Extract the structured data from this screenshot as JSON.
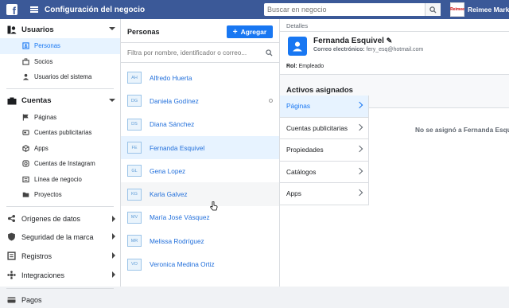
{
  "topbar": {
    "title": "Configuración del negocio",
    "search_placeholder": "Buscar en negocio",
    "account_name": "Reimee Marketing",
    "account_logo_text": "Reimee",
    "brand_color": "#3b5998"
  },
  "sidebar": {
    "users_section": "Usuarios",
    "users_items": [
      {
        "label": "Personas",
        "icon": "person-icon"
      },
      {
        "label": "Socios",
        "icon": "briefcase-icon"
      },
      {
        "label": "Usuarios del sistema",
        "icon": "system-user-icon"
      }
    ],
    "accounts_section": "Cuentas",
    "accounts_items": [
      {
        "label": "Páginas",
        "icon": "flag-icon"
      },
      {
        "label": "Cuentas publicitarias",
        "icon": "ad-account-icon"
      },
      {
        "label": "Apps",
        "icon": "app-cube-icon"
      },
      {
        "label": "Cuentas de Instagram",
        "icon": "instagram-icon"
      },
      {
        "label": "Línea de negocio",
        "icon": "business-line-icon"
      },
      {
        "label": "Proyectos",
        "icon": "folder-icon"
      }
    ],
    "sections": [
      {
        "label": "Orígenes de datos",
        "icon": "data-sources-icon"
      },
      {
        "label": "Seguridad de la marca",
        "icon": "shield-icon"
      },
      {
        "label": "Registros",
        "icon": "records-icon"
      },
      {
        "label": "Integraciones",
        "icon": "integrations-icon"
      }
    ],
    "payments": "Pagos"
  },
  "people": {
    "title": "Personas",
    "add_label": "Agregar",
    "filter_placeholder": "Filtra por nombre, identificador o correo...",
    "items": [
      {
        "initials": "AH",
        "name": "Alfredo Huerta"
      },
      {
        "initials": "DG",
        "name": "Daniela Godínez"
      },
      {
        "initials": "DS",
        "name": "Diana Sánchez"
      },
      {
        "initials": "FE",
        "name": "Fernanda Esquivel"
      },
      {
        "initials": "GL",
        "name": "Gena Lopez"
      },
      {
        "initials": "KG",
        "name": "Karla Galvez"
      },
      {
        "initials": "MV",
        "name": "María José Vásquez"
      },
      {
        "initials": "MR",
        "name": "Melissa Rodríguez"
      },
      {
        "initials": "VO",
        "name": "Veronica Medina Ortiz"
      }
    ]
  },
  "details": {
    "label": "Detalles",
    "name": "Fernanda Esquivel",
    "email_label": "Correo electrónico:",
    "email": "fery_esq@hotmail.com",
    "role_label": "Rol:",
    "role": "Empleado",
    "assigned_title": "Activos asignados",
    "categories": [
      "Páginas",
      "Cuentas publicitarias",
      "Propiedades",
      "Catálogos",
      "Apps"
    ],
    "empty_message": "No se asignó a Fernanda Esquivel"
  },
  "colors": {
    "accent": "#1877f2",
    "selected_bg": "#e7f3ff"
  }
}
